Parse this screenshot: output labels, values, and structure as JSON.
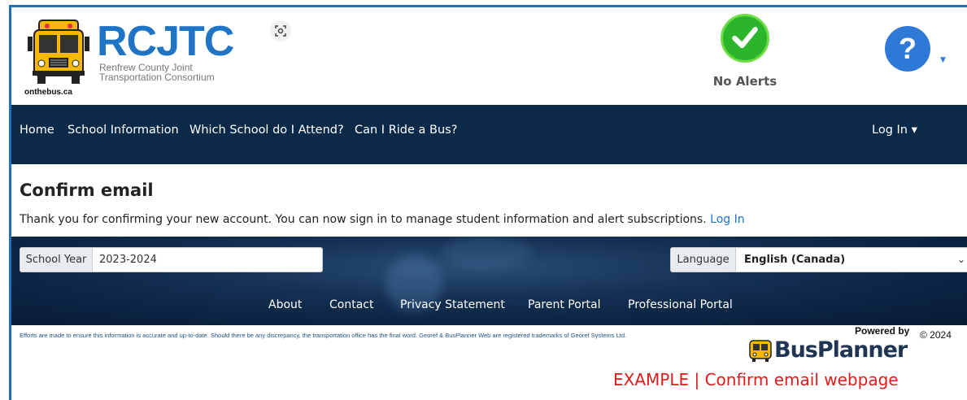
{
  "header": {
    "bus_caption": "onthebus.ca",
    "brand": "RCJTC",
    "brand_sub_line1": "Renfrew County Joint",
    "brand_sub_line2": "Transportation Consortium",
    "alert_label": "No Alerts",
    "help_symbol": "?"
  },
  "nav": {
    "items": [
      "Home",
      "School Information",
      "Which School do I Attend?",
      "Can I Ride a Bus?"
    ],
    "login_label": "Log In ▾"
  },
  "main": {
    "title": "Confirm email",
    "message": "Thank you for confirming your new account. You can now sign in to manage student information and alert subscriptions.",
    "login_link": "Log In"
  },
  "footer": {
    "school_year_label": "School Year",
    "school_year_value": "2023-2024",
    "language_label": "Language",
    "language_value": "English (Canada)",
    "links": [
      "About",
      "Contact",
      "Privacy Statement",
      "Parent Portal",
      "Professional Portal"
    ],
    "disclaimer": "Efforts are made to ensure this information is accurate and up-to-date. Should there be any discrepancy, the transportation office has the final word. Georef & BusPlanner Web are registered trademarks of Georef Systems Ltd.",
    "powered_by": "Powered by",
    "copyright": "© 2024",
    "busplanner_brand": "BusPlanner"
  },
  "caption": "EXAMPLE | Confirm email webpage",
  "colors": {
    "nav_bg": "#0b2a4a",
    "brand_blue": "#1f74c6",
    "alert_green": "#2ab52a",
    "caption_red": "#e11a1a"
  }
}
